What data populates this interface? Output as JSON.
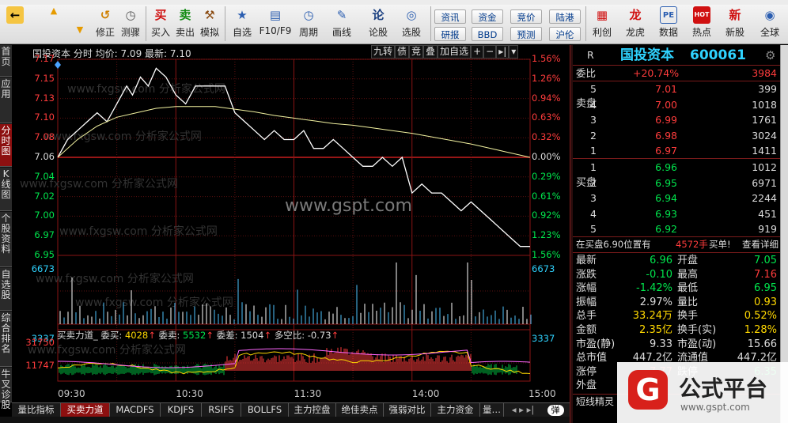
{
  "toolbar": {
    "buttons": [
      {
        "name": "back",
        "label": "",
        "icon": "←"
      },
      {
        "name": "up",
        "label": "",
        "icon": "▲"
      },
      {
        "name": "down",
        "label": "",
        "icon": "▼"
      },
      {
        "name": "revise",
        "label": "修正",
        "icon": "↺"
      },
      {
        "name": "countdown",
        "label": "测骤",
        "icon": "◷"
      },
      {
        "name": "buy",
        "label": "买入",
        "icon": "买"
      },
      {
        "name": "sell",
        "label": "卖出",
        "icon": "卖"
      },
      {
        "name": "simulate",
        "label": "模拟",
        "icon": "⚒"
      },
      {
        "name": "watchlist",
        "label": "自选",
        "icon": "★"
      },
      {
        "name": "f10",
        "label": "F10/F9",
        "icon": "▤"
      },
      {
        "name": "period",
        "label": "周期",
        "icon": "◷"
      },
      {
        "name": "draw",
        "label": "画线",
        "icon": "✎"
      },
      {
        "name": "forum",
        "label": "论股",
        "icon": "论"
      },
      {
        "name": "stock-pick",
        "label": "选股",
        "icon": "◎"
      }
    ],
    "small_buttons": [
      "资讯",
      "资金",
      "竞价",
      "陆港",
      "研报",
      "BBD",
      "预测",
      "沪伦"
    ],
    "right_buttons": [
      {
        "name": "profit",
        "label": "利创",
        "icon": "▦"
      },
      {
        "name": "dragon-tiger",
        "label": "龙虎",
        "icon": "龙"
      },
      {
        "name": "data",
        "label": "数据",
        "icon": "PE"
      },
      {
        "name": "hot",
        "label": "热点",
        "icon": "HOT"
      },
      {
        "name": "new-stock",
        "label": "新股",
        "icon": "新"
      },
      {
        "name": "global",
        "label": "全球",
        "icon": "◉"
      }
    ]
  },
  "left_tabs": [
    "首页",
    "应用",
    "分时图",
    "K线图",
    "个股资料",
    "自选股",
    "综合排名",
    "牛叉诊股"
  ],
  "chart": {
    "header": "国投资本 分时 均价: 7.09 最新: 7.10",
    "buttons": [
      "九转",
      "债",
      "竞",
      "叠",
      "加自选",
      "+",
      "−",
      "▸|",
      "▾"
    ],
    "price_labels": [
      "7.17",
      "7.15",
      "7.13",
      "7.10",
      "7.08",
      "7.06",
      "7.04",
      "7.02",
      "7.00",
      "6.97",
      "6.95"
    ],
    "pct_labels": [
      "1.56%",
      "1.26%",
      "0.94%",
      "0.63%",
      "0.32%",
      "0.00%",
      "0.29%",
      "0.61%",
      "0.92%",
      "1.23%",
      "1.56%"
    ],
    "volume_labels": [
      "6673",
      "3337"
    ],
    "indicator_header": {
      "title": "买卖力道_",
      "buy_label": "委买:",
      "buy": "4028",
      "sell_label": "委卖:",
      "sell": "5532",
      "diff_label": "委差:",
      "diff": "1504",
      "ratio_label": "多空比:",
      "ratio": "-0.73"
    },
    "indicator_labels": [
      "31750",
      "11747"
    ],
    "time_labels": [
      "09:30",
      "10:30",
      "11:30",
      "14:00",
      "15:00"
    ],
    "watermark_url": "www.gspt.com",
    "watermark_text": "www.fxgsw.com 分析家公式网"
  },
  "chart_data": {
    "type": "line",
    "title": "国投资本 分时",
    "series": [
      {
        "name": "最新",
        "color": "#ffffff",
        "x": [
          0,
          5,
          10,
          15,
          20,
          25,
          30,
          35,
          38,
          42,
          46,
          50,
          55,
          60,
          65,
          70,
          75,
          80,
          85,
          90,
          95,
          100,
          105,
          110,
          115,
          120,
          125,
          130,
          135,
          140,
          145,
          150,
          155,
          160,
          165,
          170,
          175,
          180,
          185,
          190,
          195,
          200,
          205,
          210,
          215,
          220,
          225,
          230,
          235,
          240
        ],
        "values": [
          7.06,
          7.08,
          7.09,
          7.1,
          7.11,
          7.1,
          7.12,
          7.14,
          7.13,
          7.15,
          7.14,
          7.16,
          7.15,
          7.13,
          7.12,
          7.14,
          7.14,
          7.14,
          7.14,
          7.11,
          7.1,
          7.09,
          7.08,
          7.09,
          7.08,
          7.08,
          7.09,
          7.07,
          7.07,
          7.08,
          7.07,
          7.06,
          7.05,
          7.05,
          7.06,
          7.05,
          7.06,
          7.02,
          7.03,
          7.02,
          7.02,
          7.01,
          7.0,
          7.01,
          7.0,
          6.99,
          6.98,
          6.97,
          6.96,
          6.96
        ]
      },
      {
        "name": "均价",
        "color": "#f2f2a0",
        "x": [
          0,
          10,
          20,
          30,
          40,
          50,
          60,
          70,
          80,
          90,
          100,
          110,
          120,
          130,
          140,
          150,
          160,
          170,
          180,
          190,
          200,
          210,
          220,
          230,
          240
        ],
        "values": [
          7.06,
          7.08,
          7.095,
          7.105,
          7.11,
          7.115,
          7.117,
          7.117,
          7.117,
          7.114,
          7.111,
          7.107,
          7.104,
          7.101,
          7.098,
          7.096,
          7.093,
          7.09,
          7.087,
          7.083,
          7.079,
          7.075,
          7.07,
          7.065,
          7.06
        ]
      }
    ],
    "yrange": [
      6.95,
      7.17
    ],
    "reference_price": 7.06,
    "xlabel": "",
    "ylabel": ""
  },
  "right_panel": {
    "tag": "R",
    "name": "国投资本",
    "code": "600061",
    "ratio_label": "委比",
    "ratio_pct": "+20.74%",
    "ratio_val": "3984",
    "sell_label": "卖盘",
    "buy_label": "买盘",
    "asks": [
      {
        "lvl": "5",
        "price": "7.01",
        "vol": "399"
      },
      {
        "lvl": "4",
        "price": "7.00",
        "vol": "1018"
      },
      {
        "lvl": "3",
        "price": "6.99",
        "vol": "1761"
      },
      {
        "lvl": "2",
        "price": "6.98",
        "vol": "3024"
      },
      {
        "lvl": "1",
        "price": "6.97",
        "vol": "1411"
      }
    ],
    "bids": [
      {
        "lvl": "1",
        "price": "6.96",
        "vol": "1012"
      },
      {
        "lvl": "2",
        "price": "6.95",
        "vol": "6971"
      },
      {
        "lvl": "3",
        "price": "6.94",
        "vol": "2244"
      },
      {
        "lvl": "4",
        "price": "6.93",
        "vol": "451"
      },
      {
        "lvl": "5",
        "price": "6.92",
        "vol": "919"
      }
    ],
    "note_left": "在买盘6.90位置有",
    "note_hand": "4572手",
    "note_buy": "买单!",
    "note_link": "查看详细",
    "stats": [
      {
        "l1": "最新",
        "v1": "6.96",
        "c1": "green",
        "l2": "开盘",
        "v2": "7.05",
        "c2": "green"
      },
      {
        "l1": "涨跌",
        "v1": "-0.10",
        "c1": "green",
        "l2": "最高",
        "v2": "7.16",
        "c2": "red"
      },
      {
        "l1": "涨幅",
        "v1": "-1.42%",
        "c1": "green",
        "l2": "最低",
        "v2": "6.95",
        "c2": "green"
      },
      {
        "l1": "振幅",
        "v1": "2.97%",
        "c1": "white",
        "l2": "量比",
        "v2": "0.93",
        "c2": "yellow"
      },
      {
        "l1": "总手",
        "v1": "33.24万",
        "c1": "yellow",
        "l2": "换手",
        "v2": "0.52%",
        "c2": "yellow"
      },
      {
        "l1": "金额",
        "v1": "2.35亿",
        "c1": "yellow",
        "l2": "换手(实)",
        "v2": "1.28%",
        "c2": "yellow"
      },
      {
        "l1": "市盈(静)",
        "v1": "9.33",
        "c1": "white",
        "l2": "市盈(动)",
        "v2": "15.66",
        "c2": "white"
      },
      {
        "l1": "总市值",
        "v1": "447.2亿",
        "c1": "white",
        "l2": "流通值",
        "v2": "447.2亿",
        "c2": "white"
      },
      {
        "l1": "涨停",
        "v1": "7.77",
        "c1": "red",
        "l2": "跌停",
        "v2": "6.35",
        "c2": "green"
      },
      {
        "l1": "外盘",
        "v1": "",
        "c1": "white",
        "l2": "",
        "v2": "",
        "c2": "white"
      }
    ],
    "bottom_tab": "短线精灵"
  },
  "bottom_tabs": [
    "量比指标",
    "买卖力道",
    "MACDFS",
    "KDJFS",
    "RSIFS",
    "BOLLFS",
    "主力控盘",
    "绝佳卖点",
    "强弱对比",
    "主力资金",
    "量…"
  ],
  "bottom_toggle": "弹",
  "brand": {
    "cn": "公式平台",
    "url": "www.gspt.com",
    "logo": "G"
  }
}
